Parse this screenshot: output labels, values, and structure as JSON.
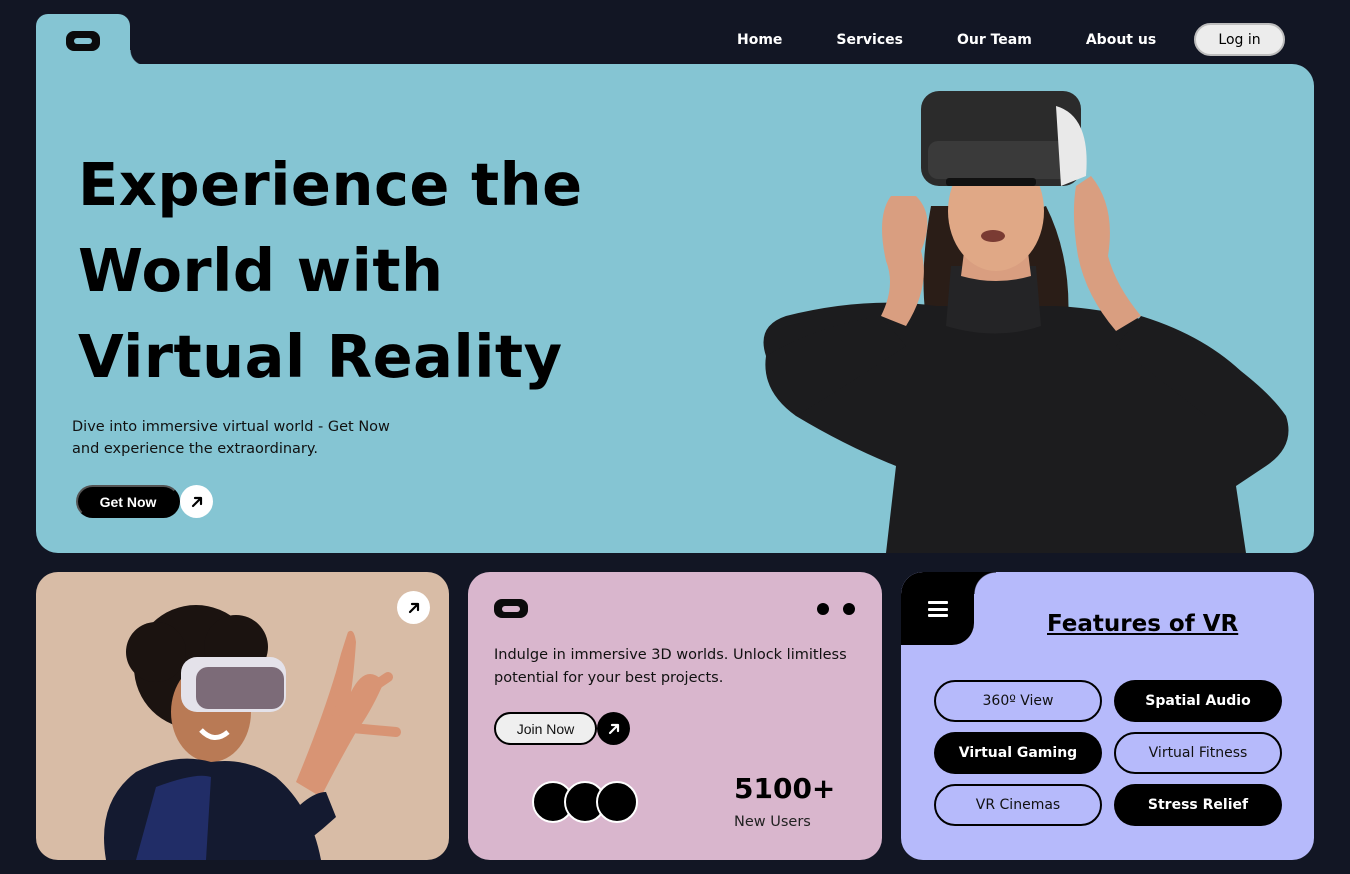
{
  "header": {
    "logo_alt": "vr-headset-logo",
    "nav": [
      "Home",
      "Services",
      "Our Team",
      "About us"
    ],
    "login_label": "Log in"
  },
  "hero": {
    "title_lines": [
      "Experience the",
      "World with",
      "Virtual Reality"
    ],
    "subtitle": "Dive into immersive virtual world - Get Now and experience the extraordinary.",
    "cta_label": "Get Now",
    "background_color": "#85c5d3"
  },
  "card_photo": {
    "background_color": "#d8bca6"
  },
  "card_join": {
    "description": "Indulge in immersive 3D worlds. Unlock limitless potential for your best projects.",
    "cta_label": "Join Now",
    "stat_value": "5100+",
    "stat_label": "New Users",
    "background_color": "#d9b6cd"
  },
  "card_features": {
    "title": "Features of VR",
    "features": [
      {
        "label": "360º View",
        "style": "outline"
      },
      {
        "label": "Spatial Audio",
        "style": "filled"
      },
      {
        "label": "Virtual Gaming",
        "style": "filled"
      },
      {
        "label": "Virtual Fitness",
        "style": "outline"
      },
      {
        "label": "VR Cinemas",
        "style": "outline"
      },
      {
        "label": "Stress Relief",
        "style": "filled"
      }
    ],
    "background_color": "#b6bafb"
  },
  "colors": {
    "page_background": "#121624",
    "accent_black": "#000000"
  }
}
